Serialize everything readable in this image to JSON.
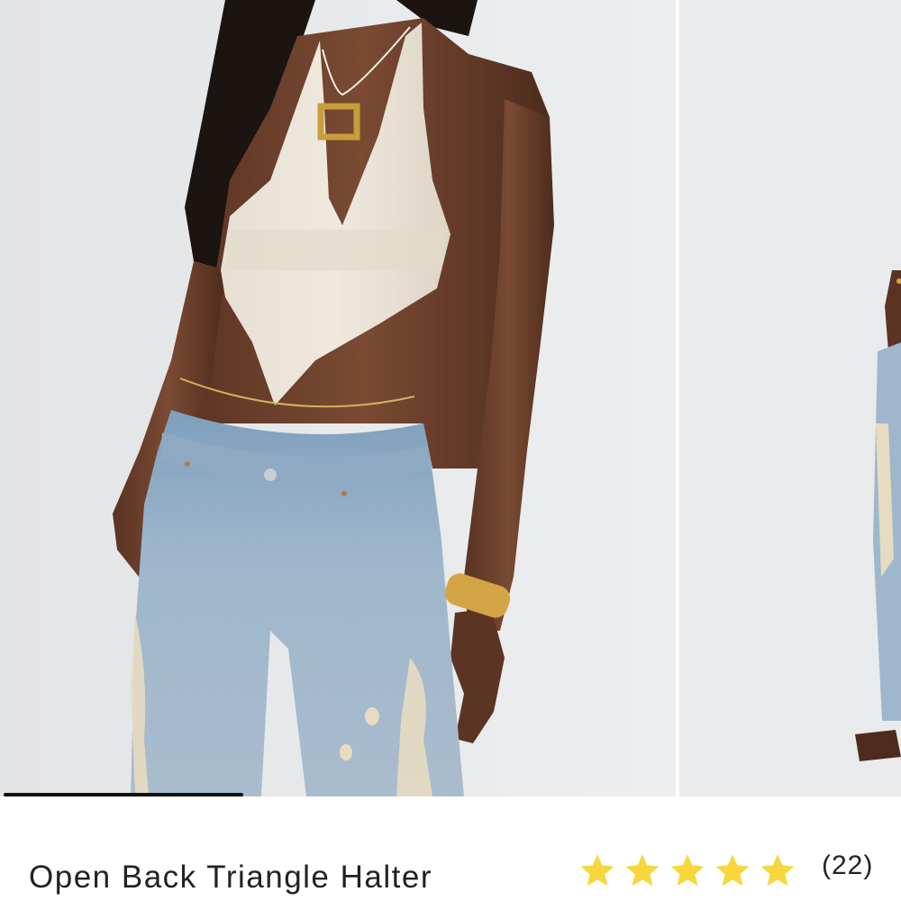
{
  "product": {
    "title": "Open Back Triangle Halter",
    "rating": {
      "stars": 5,
      "max_stars": 5,
      "review_count": "(22)",
      "star_color": "#f8d63c"
    }
  },
  "carousel": {
    "current_slide": 1,
    "progress_fraction": 0.27,
    "slides": [
      {
        "icon": "product-photo",
        "subject": "model wearing cream halter top and distressed jeans"
      },
      {
        "icon": "product-photo",
        "subject": "next photo partially visible"
      }
    ]
  },
  "colors": {
    "background": "#ffffff",
    "photo_backdrop": "#e7e8ea",
    "text": "#222222",
    "progress_bar": "#111111"
  }
}
